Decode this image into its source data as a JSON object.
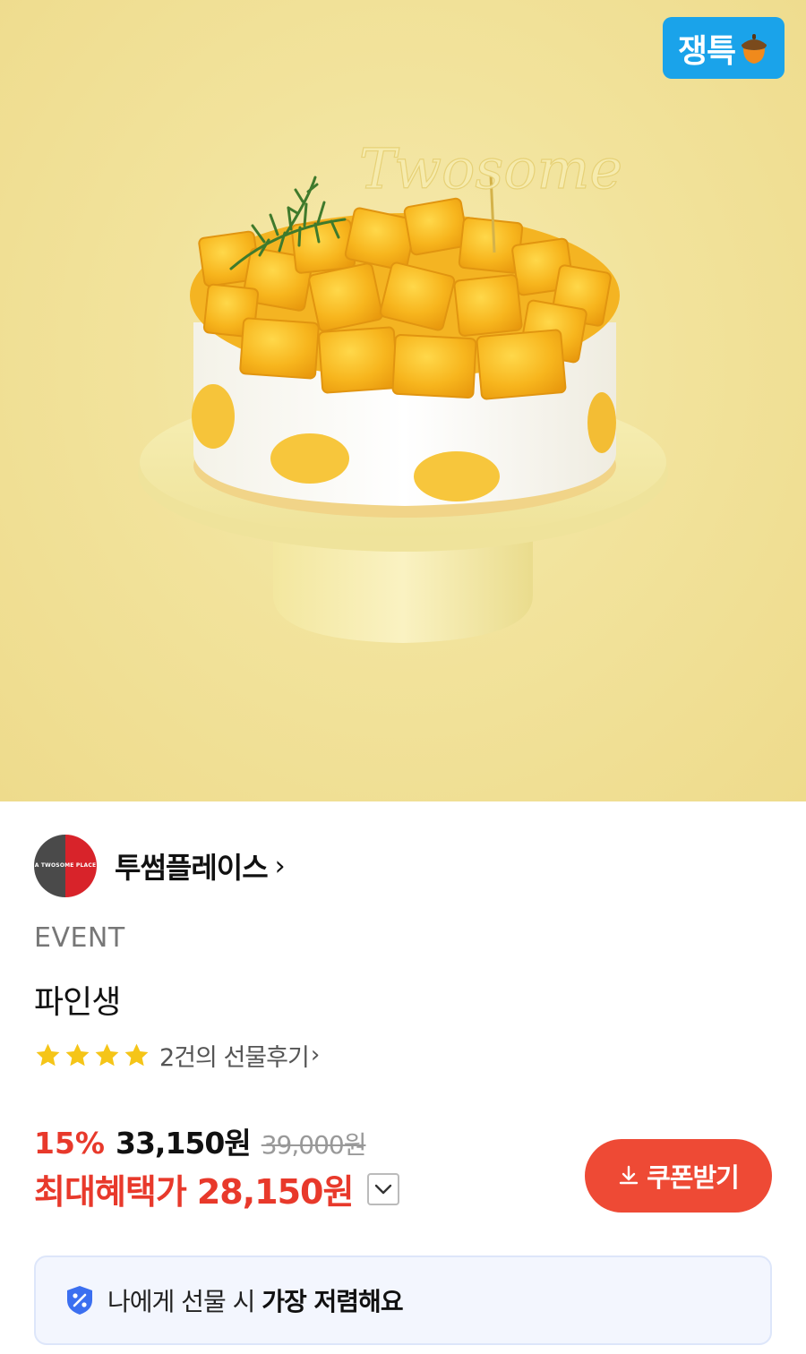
{
  "hero": {
    "topper_text": "Twosome",
    "badge_label": "쟁특",
    "badge_icon": "acorn-icon"
  },
  "brand": {
    "name": "투썸플레이스",
    "logo_text": "A TWOSOME PLACE",
    "chevron": "›"
  },
  "product": {
    "tag": "EVENT",
    "name": "파인생"
  },
  "rating": {
    "stars": 4,
    "review_text": "2건의 선물후기",
    "chevron": "›"
  },
  "price": {
    "discount": "15%",
    "sale_price": "33,150원",
    "original_price": "39,000원",
    "best_label": "최대혜택가",
    "best_price": "28,150원"
  },
  "coupon": {
    "label": "쿠폰받기",
    "icon": "download-icon"
  },
  "tip": {
    "text_prefix": "나에게 선물 시 ",
    "text_strong": "가장 저렴해요",
    "icon": "discount-shield-icon"
  },
  "colors": {
    "accent_red": "#e8392b",
    "badge_blue": "#1aa3ea",
    "star_yellow": "#f5c518",
    "tip_bg": "#f3f6fe"
  }
}
